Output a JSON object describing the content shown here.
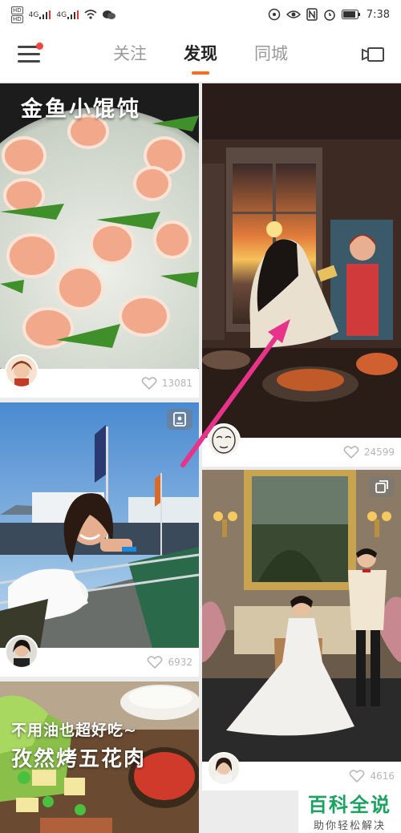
{
  "status_bar": {
    "sim1": "4G",
    "sim2": "4G",
    "time": "7:38"
  },
  "nav": {
    "tabs": [
      "关注",
      "发现",
      "同城"
    ]
  },
  "feed": [
    {
      "title": "金鱼小馄饨",
      "likes": "13081"
    },
    {
      "likes": "24599"
    },
    {
      "likes": "6932"
    },
    {
      "likes": "4616"
    },
    {
      "title_line1": "不用油也超好吃~",
      "title_line2": "孜然烤五花肉"
    }
  ],
  "watermark": {
    "brand": "百科全说",
    "slogan": "助你轻松解决"
  },
  "colors": {
    "accent": "#ff6b1a",
    "notification": "#f2453d",
    "arrow": "#e8338a",
    "watermark": "#1aa260"
  }
}
